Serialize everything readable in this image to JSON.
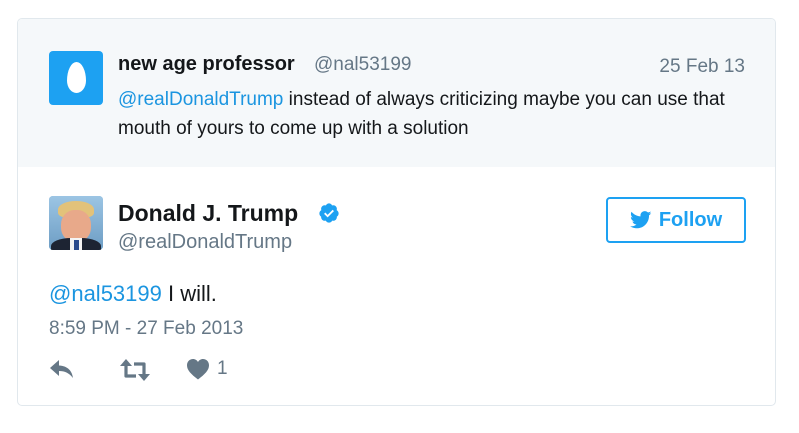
{
  "parent_tweet": {
    "avatar_icon": "egg-icon",
    "display_name": "new age professor",
    "handle": "@nal53199",
    "date": "25 Feb 13",
    "mention": "@realDonaldTrump",
    "text": " instead of always criticizing maybe you can use that mouth of yours to come up with a solution"
  },
  "tweet": {
    "display_name": "Donald J. Trump",
    "handle": "@realDonaldTrump",
    "verified": true,
    "follow_label": "Follow",
    "mention": "@nal53199",
    "text": " I will.",
    "timestamp": "8:59 PM - 27 Feb 2013",
    "like_count": "1"
  },
  "colors": {
    "accent": "#1da1f2",
    "link": "#1b95e0",
    "secondary_text": "#657786",
    "parent_background": "#f5f8fa"
  }
}
